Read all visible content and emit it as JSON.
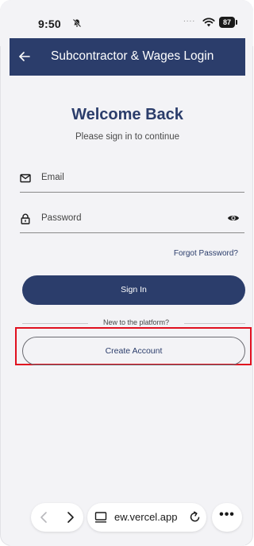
{
  "status_bar": {
    "time": "9:50",
    "signal_dots": "....",
    "battery": "87",
    "icons": [
      "bell-slash-icon",
      "wifi-icon",
      "battery-icon"
    ]
  },
  "app_bar": {
    "title": "Subcontractor & Wages Login",
    "back_icon": "arrow-left-icon"
  },
  "main": {
    "heading": "Welcome Back",
    "subheading": "Please sign in to continue",
    "email_field": {
      "placeholder": "Email",
      "value": "",
      "icon": "envelope-icon"
    },
    "password_field": {
      "placeholder": "Password",
      "value": "",
      "icon": "lock-icon",
      "toggle_icon": "eye-icon"
    },
    "forgot_password": "Forgot Password?",
    "sign_in_label": "Sign In",
    "divider_text": "New to the platform?",
    "create_account_label": "Create Account"
  },
  "browser_bar": {
    "url": "ew.vercel.app",
    "more_label": "•••",
    "icons": [
      "chevron-left-icon",
      "chevron-right-icon",
      "tabs-icon",
      "reload-icon",
      "more-icon"
    ]
  },
  "colors": {
    "primary": "#2b3d6b",
    "background": "#f3f3f6",
    "highlight": "#e0101f"
  }
}
